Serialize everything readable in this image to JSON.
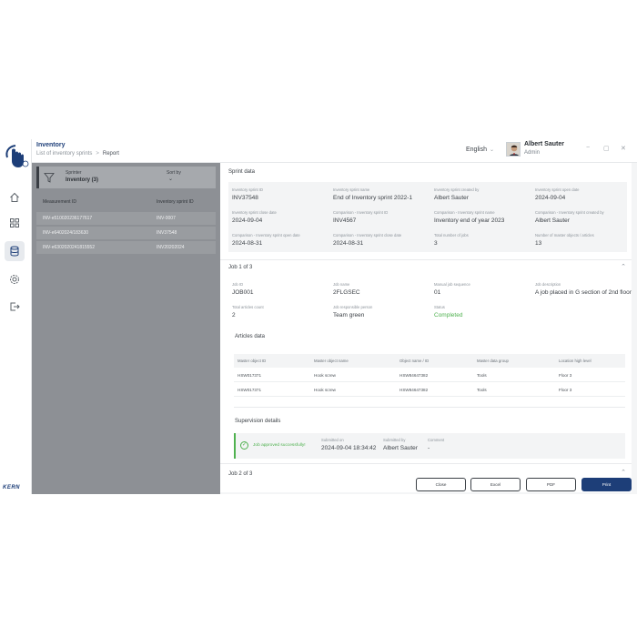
{
  "app": {
    "title": "Inventory",
    "brand": "KERN"
  },
  "breadcrumb": {
    "parent": "List of inventory sprints",
    "separator": ">",
    "current": "Report"
  },
  "header": {
    "language": "English",
    "user_name": "Albert Sauter",
    "user_role": "Admin"
  },
  "sidebar": {
    "items": [
      {
        "icon": "home-icon"
      },
      {
        "icon": "grid-icon"
      },
      {
        "icon": "database-icon"
      },
      {
        "icon": "settings-icon"
      },
      {
        "icon": "logout-icon"
      }
    ]
  },
  "list": {
    "filter_label": "Sprinter",
    "filter_value": "Inventory (3)",
    "sort_label": "Sort by",
    "sort_value": "⌄",
    "col1": "Measurement ID",
    "col2": "Inventory sprint ID",
    "rows": [
      {
        "a": "INV-e510020236177617",
        "b": "INV-0007"
      },
      {
        "a": "INV-e6402024/183630",
        "b": "INV37548"
      },
      {
        "a": "INV-e6302020241815552",
        "b": "INV20202024"
      }
    ]
  },
  "sprint": {
    "title": "Sprint data",
    "fields": [
      {
        "k": "Inventory sprint ID",
        "v": "INV37548"
      },
      {
        "k": "Inventory sprint name",
        "v": "End of Inventory sprint 2022-1"
      },
      {
        "k": "Inventory sprint created by",
        "v": "Albert Sauter"
      },
      {
        "k": "Inventory sprint open date",
        "v": "2024-09-04"
      },
      {
        "k": "Inventory sprint close date",
        "v": "2024-09-04"
      },
      {
        "k": "Comparison - Inventory sprint ID",
        "v": "INV4567"
      },
      {
        "k": "Comparison - Inventory sprint name",
        "v": "Inventory end of year 2023"
      },
      {
        "k": "Comparison - Inventory sprint created by",
        "v": "Albert Sauter"
      },
      {
        "k": "Comparison - Inventory sprint open date",
        "v": "2024-08-31"
      },
      {
        "k": "Comparison - Inventory sprint close date",
        "v": "2024-08-31"
      },
      {
        "k": "Total number of jobs",
        "v": "3"
      },
      {
        "k": "Number of master objects / articles",
        "v": "13"
      }
    ]
  },
  "job1": {
    "title": "Job 1 of 3",
    "fields": [
      {
        "k": "Job ID",
        "v": "JOB001"
      },
      {
        "k": "Job name",
        "v": "2FLGSEC"
      },
      {
        "k": "Manual job sequence",
        "v": "01"
      },
      {
        "k": "Job description",
        "v": "A job placed in G section of 2nd floor"
      },
      {
        "k": "Total articles count",
        "v": "2"
      },
      {
        "k": "Job responsible person",
        "v": "Team green"
      },
      {
        "k": "Status",
        "v": "Completed"
      }
    ],
    "articles_title": "Articles data",
    "articles_headers": [
      "Master object ID",
      "Master object name",
      "Object name / ID",
      "Master data group",
      "Location high level"
    ],
    "articles_rows": [
      [
        "HSW017371",
        "Hook screw",
        "HSW84647382",
        "Tools",
        "Floor 3"
      ],
      [
        "HSW017371",
        "Hook screw",
        "HSW84647382",
        "Tools",
        "Floor 3"
      ]
    ],
    "supervision_title": "Supervision details",
    "supervision_message": "Job approved successfully!",
    "supervision_fields": [
      {
        "k": "Submitted on",
        "v": "2024-09-04 18:34:42"
      },
      {
        "k": "Submitted by",
        "v": "Albert Sauter"
      },
      {
        "k": "Comment",
        "v": "-"
      }
    ]
  },
  "job2": {
    "title": "Job 2 of 3"
  },
  "actions": {
    "close": "Close",
    "excel": "Excel",
    "pdf": "PDF",
    "print": "Print"
  },
  "colors": {
    "accent": "#1d3e78",
    "success": "#4fb14f"
  }
}
